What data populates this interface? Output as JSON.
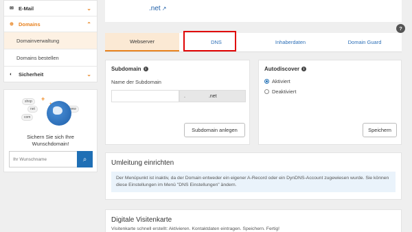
{
  "sidebar": {
    "email": "E-Mail",
    "domains": "Domains",
    "domainverwaltung": "Domainverwaltung",
    "domains_bestellen": "Domains bestellen",
    "sicherheit": "Sicherheit"
  },
  "promo": {
    "bubbles": [
      "shop",
      "net",
      "com",
      "www"
    ],
    "text_line1": "Sichern Sie sich Ihre",
    "text_line2": "Wunschdomain!",
    "search_placeholder": "Ihr Wunschname"
  },
  "header": {
    "domain": ".net"
  },
  "tabs": [
    {
      "label": "Webserver",
      "active": true
    },
    {
      "label": "DNS",
      "active": false
    },
    {
      "label": "Inhaberdaten",
      "active": false
    },
    {
      "label": "Domain Guard",
      "active": false
    }
  ],
  "subdomain": {
    "title": "Subdomain",
    "field_label": "Name der Subdomain",
    "input_value": "",
    "suffix_prefix": ".",
    "suffix_tld": ".net",
    "button": "Subdomain anlegen"
  },
  "autodiscover": {
    "title": "Autodiscover",
    "options": [
      {
        "label": "Aktiviert",
        "selected": true
      },
      {
        "label": "Deaktiviert",
        "selected": false
      }
    ],
    "button": "Speichern"
  },
  "redirect": {
    "title": "Umleitung einrichten",
    "notice": "Der Menüpunkt ist inaktiv, da der Domain entweder ein eigener A-Record oder ein DynDNS-Account zugewiesen wurde. Sie können diese Einstellungen im Menü \"DNS Einstellungen\" ändern."
  },
  "vcard": {
    "title": "Digitale Visitenkarte",
    "desc": "Visitenkarte schnell erstellt: Aktivieren. Kontaktdaten eintragen. Speichern. Fertig!"
  },
  "help_label": "?",
  "colors": {
    "accent": "#e8821e",
    "link": "#2c6fb7",
    "highlight_box": "#e00000",
    "primary_button": "#1f6fb5"
  }
}
